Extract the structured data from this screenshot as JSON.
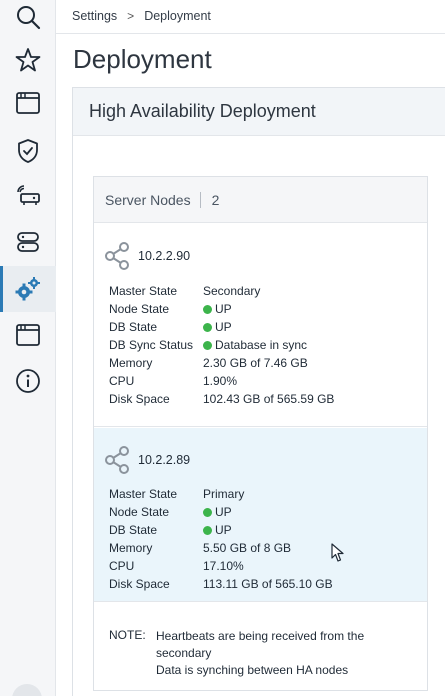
{
  "rail": {
    "items": [
      {
        "icon": "search-icon"
      },
      {
        "icon": "star-icon"
      },
      {
        "icon": "window-icon"
      },
      {
        "icon": "shield-check-icon"
      },
      {
        "icon": "network-appliance-icon"
      },
      {
        "icon": "storage-icon"
      },
      {
        "icon": "gears-icon",
        "active": true
      },
      {
        "icon": "window-icon"
      },
      {
        "icon": "info-icon"
      }
    ],
    "active_color": "#2b7ab5"
  },
  "breadcrumb": {
    "items": [
      "Settings",
      "Deployment"
    ],
    "separator": ">"
  },
  "page": {
    "title": "Deployment"
  },
  "ha": {
    "title": "High Availability Deployment",
    "nodes_label": "Server Nodes",
    "nodes_count": "2"
  },
  "nodes": [
    {
      "ip": "10.2.2.90",
      "master_state": "Secondary",
      "node_state": "UP",
      "db_state": "UP",
      "db_sync_status": "Database in sync",
      "memory": "2.30 GB of 7.46 GB",
      "cpu": "1.90%",
      "disk": "102.43 GB of 565.59 GB"
    },
    {
      "ip": "10.2.2.89",
      "master_state": "Primary",
      "node_state": "UP",
      "db_state": "UP",
      "memory": "5.50 GB of 8 GB",
      "cpu": "17.10%",
      "disk": "113.11 GB of 565.10 GB"
    }
  ],
  "labels": {
    "master_state": "Master State",
    "node_state": "Node State",
    "db_state": "DB State",
    "db_sync_status": "DB Sync Status",
    "memory": "Memory",
    "cpu": "CPU",
    "disk": "Disk Space"
  },
  "note": {
    "label": "NOTE:",
    "line1": "Heartbeats are being received from the secondary",
    "line2": "Data is synching between HA nodes"
  },
  "colors": {
    "status_up": "#3cb44b",
    "selected_row_bg": "#eaf5fb"
  }
}
